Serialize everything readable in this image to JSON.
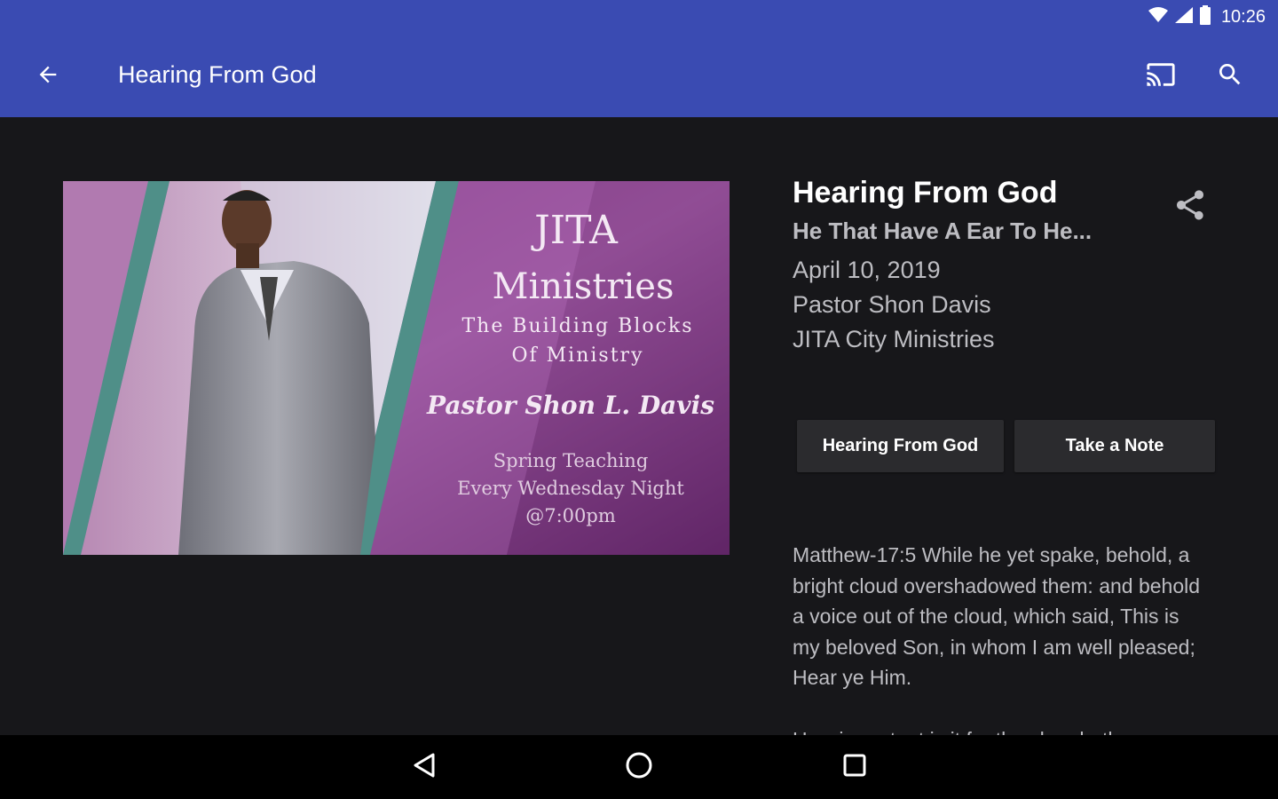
{
  "status_bar": {
    "time": "10:26",
    "icons": [
      "wifi-icon",
      "cell-signal-icon",
      "battery-icon"
    ]
  },
  "app_bar": {
    "title": "Hearing From God",
    "icons": [
      "back-arrow-icon",
      "cast-icon",
      "search-icon"
    ]
  },
  "hero_image": {
    "logo_line1": "JITA",
    "logo_line2": "Ministries",
    "tagline_line1": "The Building Blocks",
    "tagline_line2": "Of Ministry",
    "speaker": "Pastor Shon L. Davis",
    "event_line1": "Spring Teaching",
    "event_line2": "Every Wednesday Night",
    "event_line3": "@7:00pm"
  },
  "sermon": {
    "title": "Hearing From God",
    "subtitle": "He That Have A Ear To He...",
    "date": "April 10, 2019",
    "speaker": "Pastor Shon Davis",
    "ministry": "JITA City Ministries"
  },
  "actions": {
    "series_label": "Hearing From God",
    "note_label": "Take a Note"
  },
  "content": {
    "scripture": "Matthew-17:5 While he yet spake, behold, a bright cloud overshadowed them: and behold a voice out of the cloud, which said, This is my beloved Son, in whom I am well pleased;  Hear ye Him.",
    "next_line": "How important is it for the church, the"
  },
  "colors": {
    "app_bar": "#3a4bb2",
    "background": "#17171a",
    "button": "#2b2b2e",
    "secondary_text": "#bdbdc2"
  }
}
